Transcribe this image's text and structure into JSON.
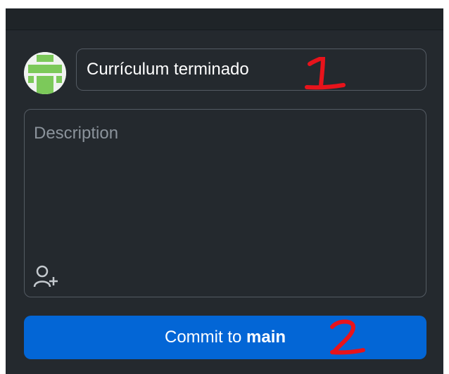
{
  "commit": {
    "summary_value": "Currículum terminado",
    "description_placeholder": "Description",
    "button_prefix": "Commit to",
    "branch": "main"
  },
  "annotations": {
    "first": "1",
    "second": "2"
  },
  "icons": {
    "avatar": "avatar-identicon",
    "coauthor": "add-coauthor-icon"
  },
  "colors": {
    "panel_bg": "#24292e",
    "input_border": "#545b63",
    "button_blue": "#0366d6",
    "annotation_red": "#e8131b",
    "avatar_green": "#7cc95a"
  }
}
